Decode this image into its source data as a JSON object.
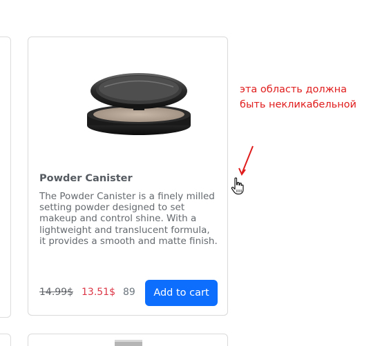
{
  "product": {
    "title": "Powder Canister",
    "description": "The Powder Canister is a finely milled setting powder designed to set makeup and control shine. With a lightweight and translucent formula, it provides a smooth and matte finish.",
    "old_price": "14.99$",
    "new_price": "13.51$",
    "stock": "89",
    "add_to_cart_label": "Add to cart",
    "image_icon": "powder-compact-image"
  },
  "annotation": {
    "text": "эта область должна быть некликабельной",
    "color": "#e01b1b"
  },
  "colors": {
    "button": "#0d6efd",
    "discount_price": "#dc3545"
  }
}
